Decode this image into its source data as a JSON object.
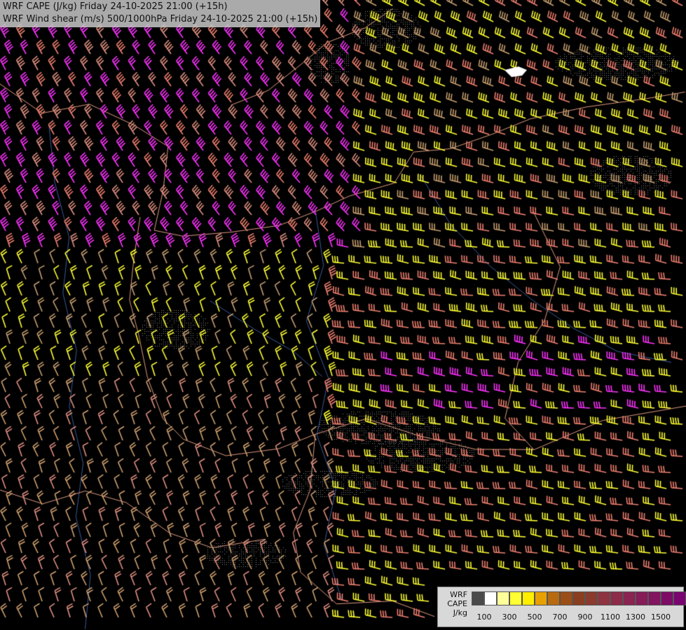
{
  "titles": {
    "line1": "WRF CAPE (J/kg) Friday 24-10-2025 21:00 (+15h)",
    "line2": "WRF Wind shear (m/s) 500/1000hPa Friday 24-10-2025 21:00 (+15h)"
  },
  "legend": {
    "label_model": "WRF",
    "label_field": "CAPE",
    "label_unit": "J/kg",
    "colors": [
      "#4a4a4a",
      "#ffffff",
      "#ffff99",
      "#ffff33",
      "#ffee00",
      "#e8a000",
      "#b86a10",
      "#9a4e18",
      "#8a3e20",
      "#8b3a2e",
      "#8e3340",
      "#8c2c48",
      "#8a2450",
      "#861c58",
      "#821460",
      "#7e0c66",
      "#7a0470"
    ],
    "ticks": [
      "100",
      "300",
      "500",
      "700",
      "900",
      "1100",
      "1300",
      "1500"
    ]
  },
  "barb_colors": {
    "low": "#d0a070",
    "mid": "#e09080",
    "high": "#ffff33",
    "strong": "#ff33ff",
    "salmon": "#f08070",
    "tan": "#c8a070"
  }
}
